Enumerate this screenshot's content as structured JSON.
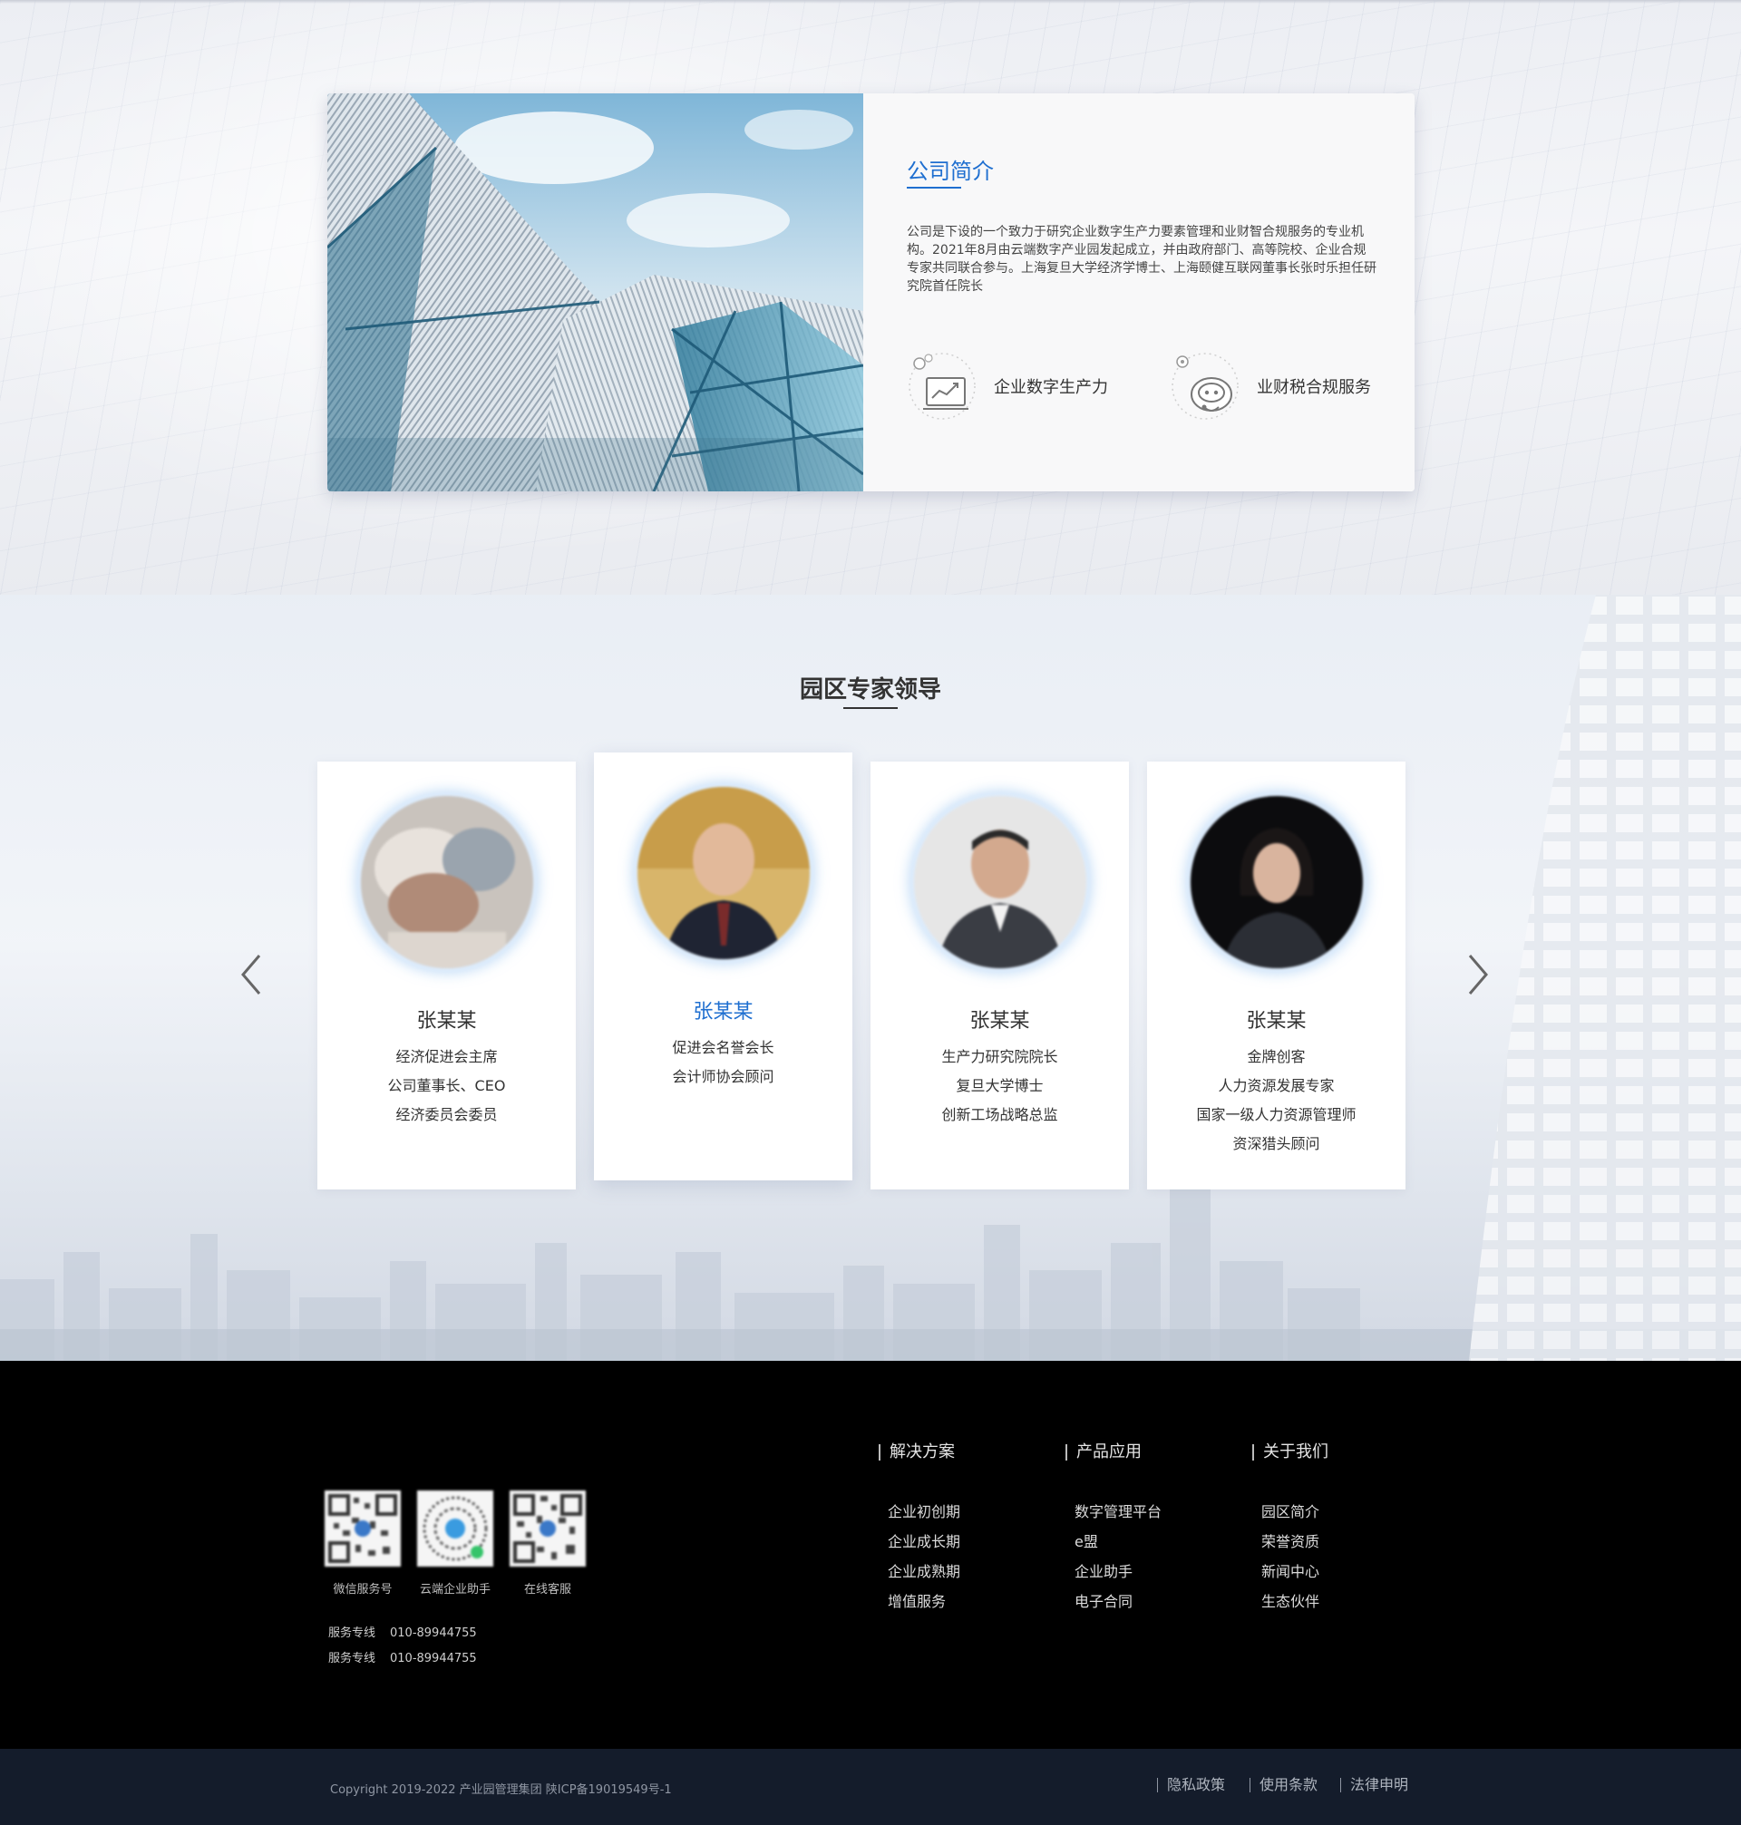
{
  "intro": {
    "title": "公司简介",
    "description": "公司是下设的一个致力于研究企业数字生产力要素管理和业财智合规服务的专业机构。2021年8月由云端数字产业园发起成立，并由政府部门、高等院校、企业合规专家共同联合参与。上海复旦大学经济学博士、上海颐健互联网董事长张时乐担任研究院首任院长",
    "features": [
      {
        "label": "企业数字生产力",
        "icon": "chart-screen-icon"
      },
      {
        "label": "业财税合规服务",
        "icon": "service-bot-icon"
      }
    ]
  },
  "experts": {
    "title": "园区专家领导",
    "cards": [
      {
        "name": "张某某",
        "lines": [
          "经济促进会主席",
          "公司董事长、CEO",
          "经济委员会委员"
        ]
      },
      {
        "name": "张某某",
        "lines": [
          "促进会名誉会长",
          "会计师协会顾问"
        ]
      },
      {
        "name": "张某某",
        "lines": [
          "生产力研究院院长",
          "复旦大学博士",
          "创新工场战略总监"
        ]
      },
      {
        "name": "张某某",
        "lines": [
          "金牌创客",
          "人力资源发展专家",
          "国家一级人力资源管理师",
          "资深猎头顾问"
        ]
      }
    ],
    "active_index": 1
  },
  "footer": {
    "qr_codes": [
      {
        "label": "微信服务号"
      },
      {
        "label": "云端企业助手"
      },
      {
        "label": "在线客服"
      }
    ],
    "hotlines": [
      {
        "label": "服务专线",
        "number": "010-89944755"
      },
      {
        "label": "服务专线",
        "number": "010-89944755"
      }
    ],
    "columns": [
      {
        "title": "解决方案",
        "items": [
          "企业初创期",
          "企业成长期",
          "企业成熟期",
          "增值服务"
        ]
      },
      {
        "title": "产品应用",
        "items": [
          "数字管理平台",
          "e盟",
          "企业助手",
          "电子合同"
        ]
      },
      {
        "title": "关于我们",
        "items": [
          "园区简介",
          "荣誉资质",
          "新闻中心",
          "生态伙伴"
        ]
      }
    ]
  },
  "bottom": {
    "copyright": "Copyright 2019-2022 产业园管理集团 陕ICP备19019549号-1",
    "links": [
      "隐私政策",
      "使用条款",
      "法律申明"
    ]
  },
  "colors": {
    "accent": "#1f6fd0",
    "footer_bg": "#000000",
    "bottom_bar_bg": "#141c2b"
  }
}
